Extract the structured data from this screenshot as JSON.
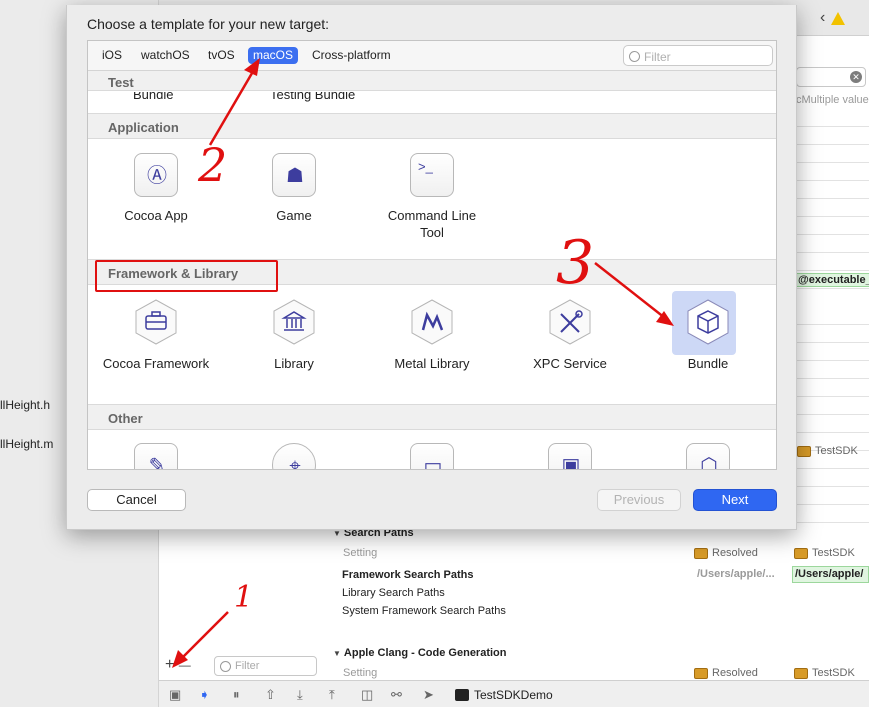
{
  "background": {
    "files": [
      "llHeight.h",
      "llHeight.m"
    ],
    "multiple_values": "cMultiple value",
    "executable": "@executable_",
    "target_tags": [
      "TestSDK",
      "TestSDK",
      "TestSDK"
    ],
    "resolved_labels": [
      "Resolved",
      "Resolved"
    ],
    "search_paths_header": "Search Paths",
    "setting_label": "Setting",
    "rows": [
      "Framework Search Paths",
      "Library Search Paths",
      "System Framework Search Paths"
    ],
    "path_resolved": "/Users/apple/...",
    "path_target": "/Users/apple/",
    "clang_header": "Apple Clang - Code Generation",
    "setting_label2": "Setting",
    "filter_placeholder": "Filter",
    "scheme": "TestSDKDemo",
    "plus": "+",
    "minus": "—"
  },
  "dialog": {
    "title": "Choose a template for your new target:",
    "tabs": [
      "iOS",
      "watchOS",
      "tvOS",
      "macOS",
      "Cross-platform"
    ],
    "active_tab": "macOS",
    "filter_placeholder": "Filter",
    "sections": {
      "test": "Test",
      "application": "Application",
      "framework": "Framework & Library",
      "other": "Other"
    },
    "test_cut_labels": [
      "Bundle",
      "Testing Bundle"
    ],
    "application_items": [
      "Cocoa App",
      "Game",
      "Command Line Tool"
    ],
    "framework_items": [
      "Cocoa Framework",
      "Library",
      "Metal Library",
      "XPC Service",
      "Bundle"
    ],
    "selected_item": "Bundle",
    "buttons": {
      "cancel": "Cancel",
      "previous": "Previous",
      "next": "Next"
    }
  },
  "annotations": {
    "one": "1",
    "two": "2",
    "three": "3"
  },
  "colors": {
    "accent": "#2f67f2",
    "annotation": "#e01010",
    "icon": "#3d3d9e"
  }
}
